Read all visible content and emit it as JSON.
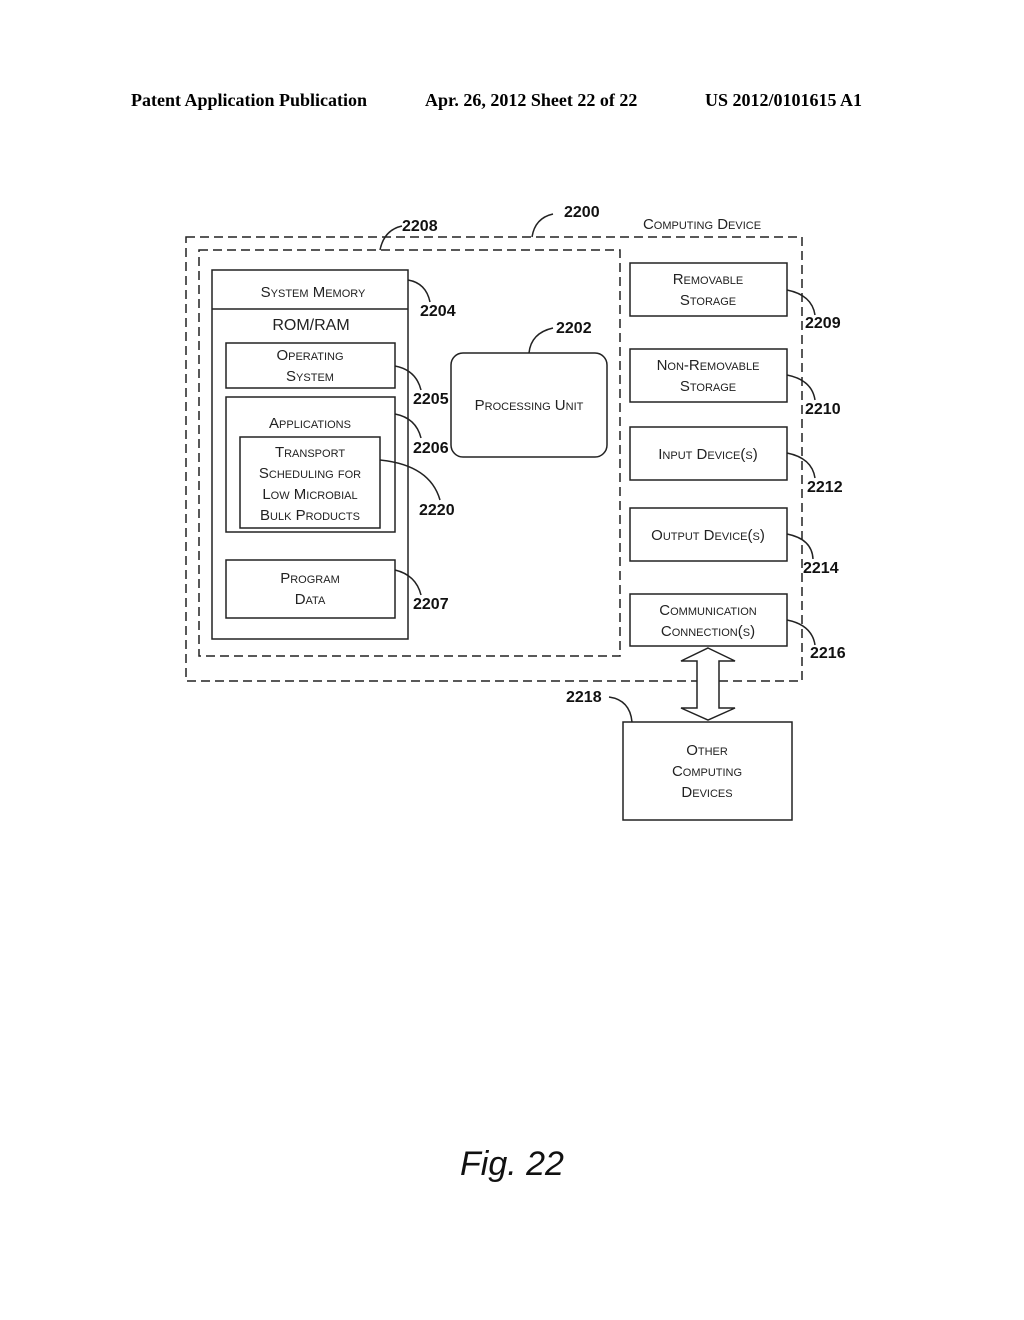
{
  "header": {
    "publication": "Patent Application Publication",
    "date_sheet": "Apr. 26, 2012  Sheet 22 of 22",
    "number": "US 2012/0101615 A1"
  },
  "diagram": {
    "computing_device": {
      "label": "Computing Device",
      "ref": "2200"
    },
    "basic_config": {
      "ref": "2208"
    },
    "system_memory": {
      "label": "System Memory",
      "ref": "2204",
      "sublabel": "ROM/RAM"
    },
    "operating_system": {
      "line1": "Operating",
      "line2": "System",
      "ref": "2205"
    },
    "applications": {
      "label": "Applications",
      "ref": "2206"
    },
    "transport_app": {
      "line1": "Transport",
      "line2": "Scheduling for",
      "line3": "Low Microbial",
      "line4": "Bulk Products",
      "ref": "2220"
    },
    "program_data": {
      "line1": "Program",
      "line2": "Data",
      "ref": "2207"
    },
    "processing_unit": {
      "label": "Processing Unit",
      "ref": "2202"
    },
    "removable_storage": {
      "line1": "Removable",
      "line2": "Storage",
      "ref": "2209"
    },
    "non_removable_storage": {
      "line1": "Non-Removable",
      "line2": "Storage",
      "ref": "2210"
    },
    "input_devices": {
      "label": "Input Device(s)",
      "ref": "2212"
    },
    "output_devices": {
      "label": "Output Device(s)",
      "ref": "2214"
    },
    "communication": {
      "line1": "Communication",
      "line2": "Connection(s)",
      "ref": "2216"
    },
    "other_devices": {
      "line1": "Other",
      "line2": "Computing",
      "line3": "Devices",
      "ref": "2218"
    }
  },
  "figure": {
    "caption": "Fig. 22"
  }
}
